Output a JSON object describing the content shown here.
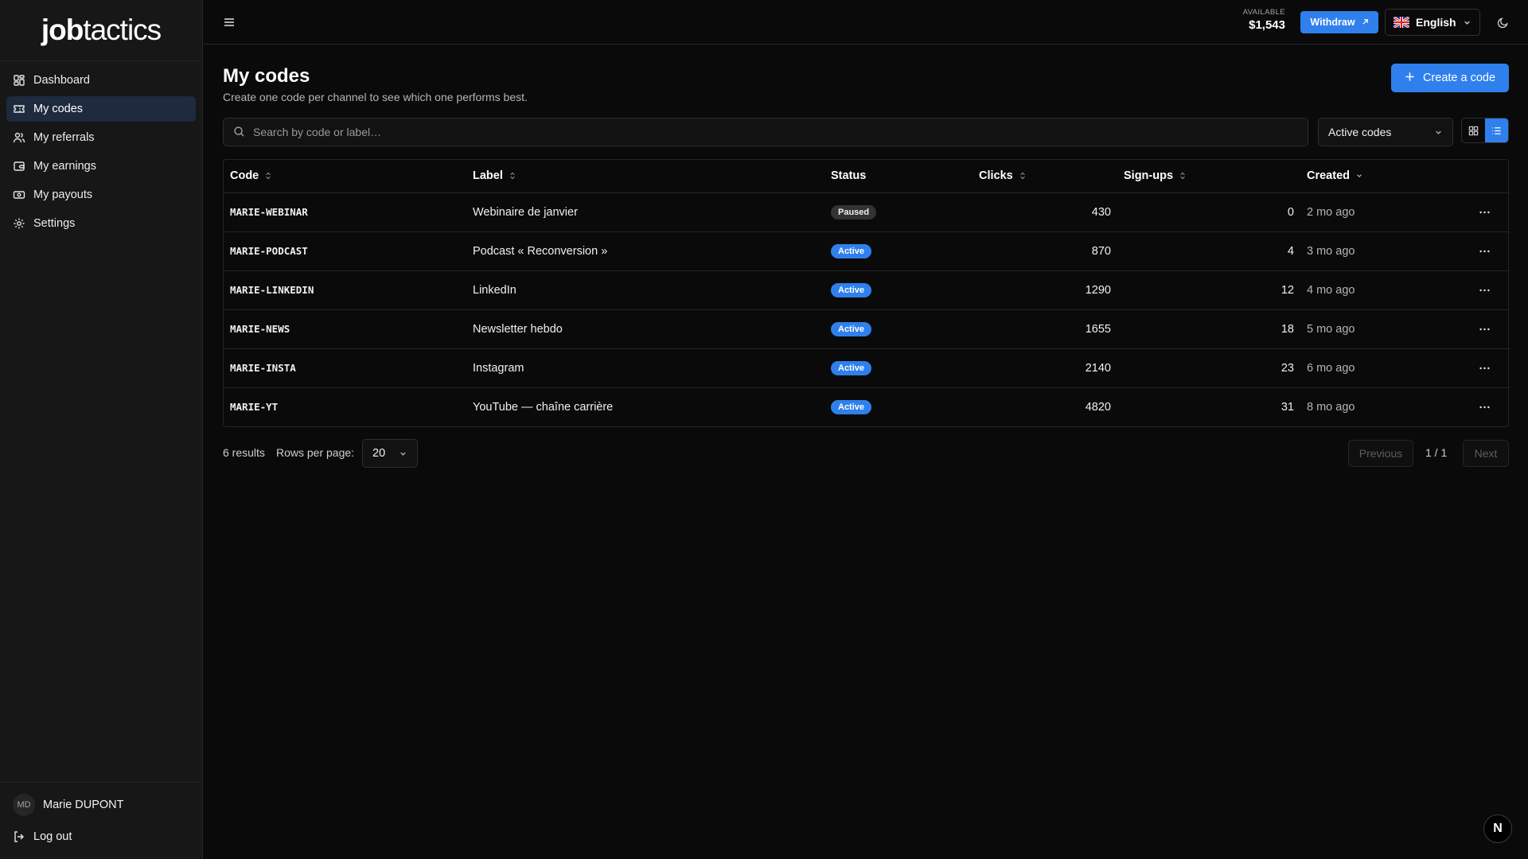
{
  "brand": {
    "bold": "job",
    "light": "tactics"
  },
  "sidebar": {
    "items": [
      {
        "label": "Dashboard",
        "icon": "dashboard-grid-icon"
      },
      {
        "label": "My codes",
        "icon": "ticket-icon",
        "active": true
      },
      {
        "label": "My referrals",
        "icon": "users-icon"
      },
      {
        "label": "My earnings",
        "icon": "wallet-icon"
      },
      {
        "label": "My payouts",
        "icon": "banknote-icon"
      },
      {
        "label": "Settings",
        "icon": "gear-icon"
      }
    ],
    "user": {
      "initials": "MD",
      "name": "Marie DUPONT"
    },
    "logout_label": "Log out"
  },
  "topbar": {
    "available_label": "AVAILABLE",
    "available_amount": "$1,543",
    "withdraw_label": "Withdraw",
    "language": "English"
  },
  "page": {
    "title": "My codes",
    "subtitle": "Create one code per channel to see which one performs best.",
    "create_label": "Create a code",
    "search_placeholder": "Search by code or label…",
    "filter_value": "Active codes"
  },
  "table": {
    "headers": {
      "code": "Code",
      "label": "Label",
      "status": "Status",
      "clicks": "Clicks",
      "signups": "Sign-ups",
      "created": "Created"
    },
    "rows": [
      {
        "code": "MARIE-WEBINAR",
        "label": "Webinaire de janvier",
        "status": "Paused",
        "clicks": "430",
        "signups": "0",
        "created": "2 mo ago"
      },
      {
        "code": "MARIE-PODCAST",
        "label": "Podcast « Reconversion »",
        "status": "Active",
        "clicks": "870",
        "signups": "4",
        "created": "3 mo ago"
      },
      {
        "code": "MARIE-LINKEDIN",
        "label": "LinkedIn",
        "status": "Active",
        "clicks": "1290",
        "signups": "12",
        "created": "4 mo ago"
      },
      {
        "code": "MARIE-NEWS",
        "label": "Newsletter hebdo",
        "status": "Active",
        "clicks": "1655",
        "signups": "18",
        "created": "5 mo ago"
      },
      {
        "code": "MARIE-INSTA",
        "label": "Instagram",
        "status": "Active",
        "clicks": "2140",
        "signups": "23",
        "created": "6 mo ago"
      },
      {
        "code": "MARIE-YT",
        "label": "YouTube — chaîne carrière",
        "status": "Active",
        "clicks": "4820",
        "signups": "31",
        "created": "8 mo ago"
      }
    ]
  },
  "footer": {
    "results": "6 results",
    "rows_per_page_label": "Rows per page:",
    "rows_per_page_value": "20",
    "previous_label": "Previous",
    "next_label": "Next",
    "page_indicator": "1 / 1"
  },
  "fab_label": "N",
  "colors": {
    "accent": "#2f80ed",
    "background": "#0a0a0a",
    "sidebar": "#171717",
    "active_nav": "#1e2a3d"
  }
}
